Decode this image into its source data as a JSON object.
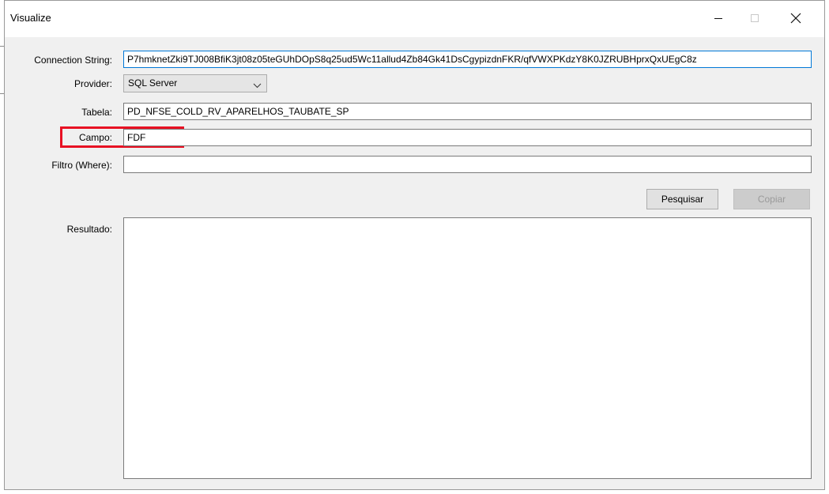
{
  "window": {
    "title": "Visualize",
    "minimize_label": "Minimize",
    "maximize_label": "Maximize",
    "close_label": "Close"
  },
  "form": {
    "connection_string": {
      "label": "Connection String:",
      "value": "P7hmknetZki9TJ008BfiK3jt08z05teGUhDOpS8q25ud5Wc11allud4Zb84Gk41DsCgypizdnFKR/qfVWXPKdzY8K0JZRUBHprxQxUEgC8z"
    },
    "provider": {
      "label": "Provider:",
      "selected": "SQL Server"
    },
    "tabela": {
      "label": "Tabela:",
      "value": "PD_NFSE_COLD_RV_APARELHOS_TAUBATE_SP"
    },
    "campo": {
      "label": "Campo:",
      "value": "FDF"
    },
    "filtro": {
      "label": "Filtro (Where):",
      "value": ""
    },
    "resultado": {
      "label": "Resultado:",
      "value": ""
    }
  },
  "buttons": {
    "pesquisar": "Pesquisar",
    "copiar": "Copiar"
  },
  "colors": {
    "highlight": "#e81123",
    "focus_border": "#0078d7"
  }
}
